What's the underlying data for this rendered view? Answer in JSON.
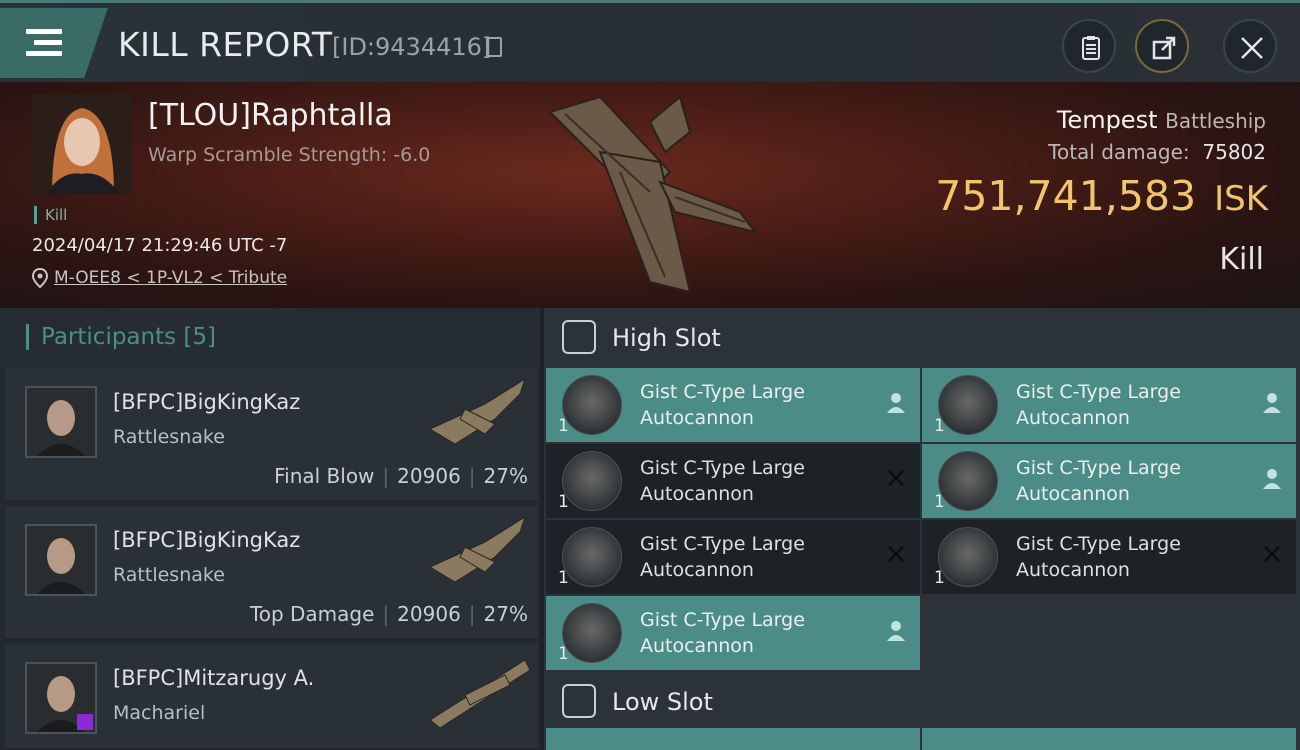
{
  "header": {
    "title": "KILL REPORT",
    "kill_id": "[ID:9434416]"
  },
  "victim": {
    "name": "[TLOU]Raphtalla",
    "subtitle": "Warp Scramble Strength: -6.0",
    "kill_tag": "Kill",
    "date": "2024/04/17 21:29:46 UTC -7",
    "location": "M-OEE8 < 1P-VL2 < Tribute",
    "ship_name": "Tempest",
    "ship_class": "Battleship",
    "total_damage_label": "Total damage:",
    "total_damage": "75802",
    "isk_value": "751,741,583",
    "isk_unit": "ISK",
    "result": "Kill"
  },
  "participants": {
    "title": "Participants",
    "count": "[5]",
    "rows": [
      {
        "name": "[BFPC]BigKingKaz",
        "ship": "Rattlesnake",
        "role": "Final Blow",
        "damage": "20906",
        "percent": "27%"
      },
      {
        "name": "[BFPC]BigKingKaz",
        "ship": "Rattlesnake",
        "role": "Top Damage",
        "damage": "20906",
        "percent": "27%"
      },
      {
        "name": "[BFPC]Mitzarugy A.",
        "ship": "Machariel"
      }
    ]
  },
  "slots": {
    "high_title": "High Slot",
    "low_title": "Low Slot",
    "high_modules": [
      {
        "line1": "Gist C-Type Large",
        "line2": "Autocannon",
        "qty": "1",
        "state": "dropped"
      },
      {
        "line1": "Gist C-Type Large",
        "line2": "Autocannon",
        "qty": "1",
        "state": "dropped"
      },
      {
        "line1": "Gist C-Type Large",
        "line2": "Autocannon",
        "qty": "1",
        "state": "destroyed"
      },
      {
        "line1": "Gist C-Type Large",
        "line2": "Autocannon",
        "qty": "1",
        "state": "dropped"
      },
      {
        "line1": "Gist C-Type Large",
        "line2": "Autocannon",
        "qty": "1",
        "state": "destroyed"
      },
      {
        "line1": "Gist C-Type Large",
        "line2": "Autocannon",
        "qty": "1",
        "state": "destroyed"
      },
      {
        "line1": "Gist C-Type Large",
        "line2": "Autocannon",
        "qty": "1",
        "state": "dropped"
      }
    ]
  },
  "icons": {
    "menu": "menu-icon",
    "copy": "copy-icon",
    "clipboard": "clipboard-icon",
    "share": "share-icon",
    "close": "close-icon",
    "pin": "location-pin-icon",
    "dropped": "person-icon",
    "destroyed": "x-icon"
  },
  "colors": {
    "accent": "#4e8c8a",
    "isk": "#f2c56a",
    "dropped_bg": "#4b8d86",
    "destroyed_bg": "#1c2226"
  }
}
